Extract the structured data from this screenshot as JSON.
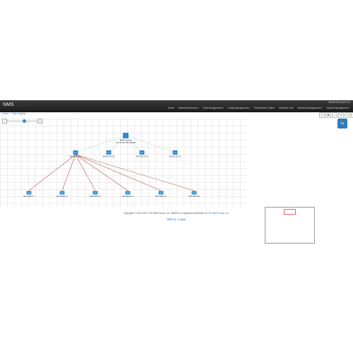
{
  "app": {
    "title": "NMS",
    "clock": "2019/07/03 15:07:37"
  },
  "user": {
    "label": "admin"
  },
  "menu": [
    "Home",
    "Network Discovery ▾",
    "Fault Management ▾",
    "Config Management ▾",
    "Performance Collect",
    "Schedule Task",
    "Business Management ▾",
    "System Management ▾"
  ],
  "breadcrumb": {
    "home": "Home",
    "current": "Topo Display"
  },
  "zoom": {
    "level_fraction": 0.55,
    "minus": "−",
    "plus": "+"
  },
  "toolbar_icons": [
    "refresh-icon",
    "save-icon",
    "fit-icon",
    "zoom-in-icon",
    "zoom-out-icon",
    "settings-icon"
  ],
  "side_button": {
    "label": "⇆"
  },
  "topology": {
    "root": {
      "name": "NMS-Server",
      "ip": "172.16.40.254-EPON"
    },
    "olts": [
      {
        "tag": "OLT",
        "name": "EPON-OLT1"
      },
      {
        "tag": "OLT",
        "name": "EPON-OLT2"
      },
      {
        "tag": "OLT",
        "name": "EPON-OLT3"
      },
      {
        "tag": "OLT",
        "name": "EPON-OLT4"
      }
    ],
    "onus": [
      {
        "tag": "ONU",
        "name": "EPON0/1:1"
      },
      {
        "tag": "ONU",
        "name": "EPON0/1:2"
      },
      {
        "tag": "ONU",
        "name": "EPON0/1:3"
      },
      {
        "tag": "ONU",
        "name": "EPON0/1:4"
      },
      {
        "tag": "ONU",
        "name": "EPON0/1:5"
      },
      {
        "tag": "ONU",
        "name": "EPON0/1:6"
      }
    ]
  },
  "footer": {
    "copyright": "Copyright © 2002-2017 The NMS Group, Inc. NMS® is a registered trademark of",
    "company_link": "The NMS Group, Inc.",
    "lang_zh": "简体中文",
    "lang_en": "English"
  },
  "colors": {
    "accent": "#337ab7",
    "link_red": "#c0504d",
    "link_green": "#9bd89b",
    "node": "#2a8ccd"
  }
}
